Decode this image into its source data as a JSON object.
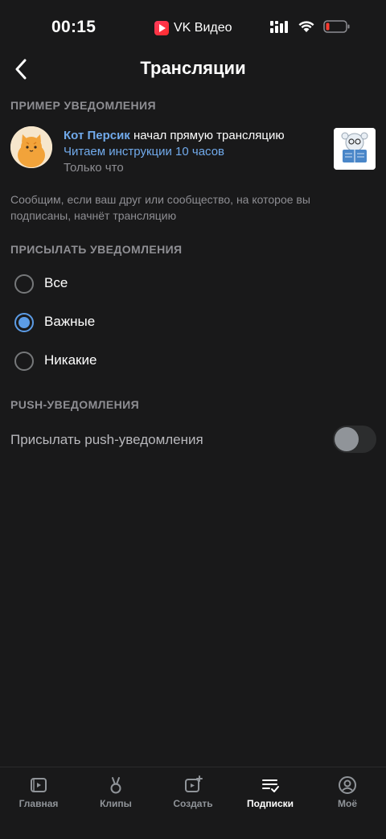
{
  "status_bar": {
    "time": "00:15",
    "app_name": "VK Видео",
    "icons": [
      "signal-icon",
      "wifi-icon",
      "battery-low-icon"
    ]
  },
  "nav": {
    "title": "Трансляции",
    "back_icon": "chevron-left-icon"
  },
  "sections": {
    "example_header": "ПРИМЕР УВЕДОМЛЕНИЯ",
    "send_header": "ПРИСЫЛАТЬ УВЕДОМЛЕНИЯ",
    "push_header": "PUSH-УВЕДОМЛЕНИЯ"
  },
  "notification": {
    "author": "Кот Персик",
    "action": " начал прямую трансляцию",
    "stream_title": "Читаем инструкции 10 часов",
    "time": "Только что"
  },
  "hint": "Сообщим, если ваш друг или сообщество, на которое вы подписаны, начнёт трансляцию",
  "options": [
    {
      "label": "Все",
      "checked": false
    },
    {
      "label": "Важные",
      "checked": true
    },
    {
      "label": "Никакие",
      "checked": false
    }
  ],
  "push": {
    "label": "Присылать push-уведомления",
    "enabled": false
  },
  "tabs": [
    {
      "label": "Главная",
      "icon": "video-icon",
      "active": false
    },
    {
      "label": "Клипы",
      "icon": "clips-icon",
      "active": false
    },
    {
      "label": "Создать",
      "icon": "create-video-icon",
      "active": false
    },
    {
      "label": "Подписки",
      "icon": "subscriptions-icon",
      "active": true
    },
    {
      "label": "Моё",
      "icon": "profile-icon",
      "active": false
    }
  ],
  "colors": {
    "background": "#19191a",
    "accent": "#5c9ce6",
    "link": "#71aaeb",
    "secondary_text": "#8e8e93"
  }
}
